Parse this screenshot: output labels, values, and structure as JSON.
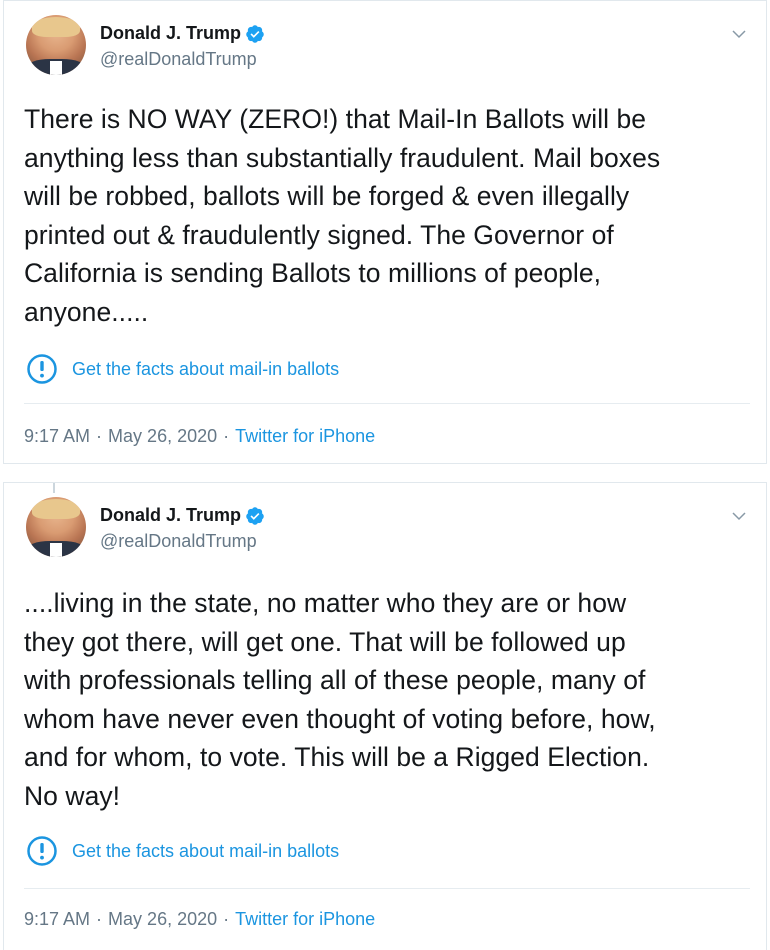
{
  "colors": {
    "accent": "#1b95e0",
    "verified": "#1da1f2",
    "text": "#14171a",
    "muted": "#657786",
    "border": "#e1e8ed"
  },
  "tweets": [
    {
      "author": {
        "name": "Donald J. Trump",
        "handle": "@realDonaldTrump",
        "verified_icon": "verified-badge-icon",
        "avatar": "profile-photo"
      },
      "text": "There is NO WAY (ZERO!) that Mail-In Ballots will be\nanything less than substantially fraudulent. Mail boxes\nwill be robbed, ballots will be forged & even illegally\nprinted out & fraudulently signed. The Governor of\nCalifornia is sending Ballots to millions of people,\nanyone.....",
      "fact_check": {
        "icon": "exclamation-circle-icon",
        "label": "Get the facts about mail-in ballots"
      },
      "meta": {
        "time": "9:17 AM",
        "separator_1": "·",
        "date": "May 26, 2020",
        "separator_2": "·",
        "source": "Twitter for iPhone"
      }
    },
    {
      "author": {
        "name": "Donald J. Trump",
        "handle": "@realDonaldTrump",
        "verified_icon": "verified-badge-icon",
        "avatar": "profile-photo"
      },
      "text": "....living in the state, no matter who they are or how\nthey got there, will get one. That will be followed up\nwith professionals telling all of these people, many of\nwhom have never even thought of voting before, how,\nand for whom, to vote. This will be a Rigged Election.\nNo way!",
      "fact_check": {
        "icon": "exclamation-circle-icon",
        "label": "Get the facts about mail-in ballots"
      },
      "meta": {
        "time": "9:17 AM",
        "separator_1": "·",
        "date": "May 26, 2020",
        "separator_2": "·",
        "source": "Twitter for iPhone"
      }
    }
  ]
}
